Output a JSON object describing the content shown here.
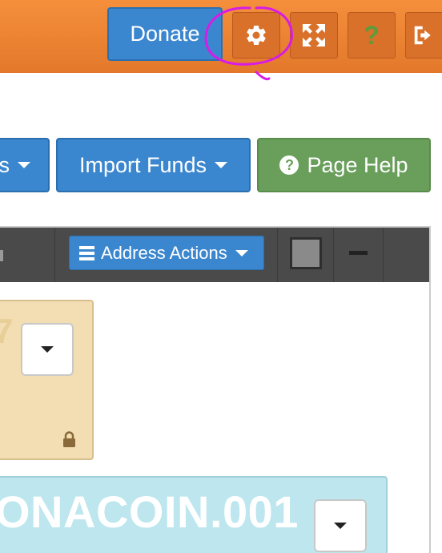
{
  "header": {
    "donate_label": "Donate",
    "icons": [
      "gear-icon",
      "fullscreen-icon",
      "help-icon",
      "logout-icon"
    ],
    "help_glyph": "?"
  },
  "toolbar": {
    "partial_label": "s",
    "import_label": "Import Funds",
    "help_label": "Page Help",
    "help_icon_glyph": "?"
  },
  "action_bar": {
    "address_actions_label": "Address Actions"
  },
  "cards": {
    "tan_partial_text": "7",
    "blue_label": "ONACOIN.001"
  },
  "colors": {
    "header_orange": "#f0873a",
    "primary_blue": "#3b87cf",
    "help_green": "#6a9f5b",
    "dark_bar": "#4a4a4a",
    "tan_card": "#f3deb3",
    "blue_card": "#bde6ef",
    "annotation_magenta": "#d81be6"
  }
}
